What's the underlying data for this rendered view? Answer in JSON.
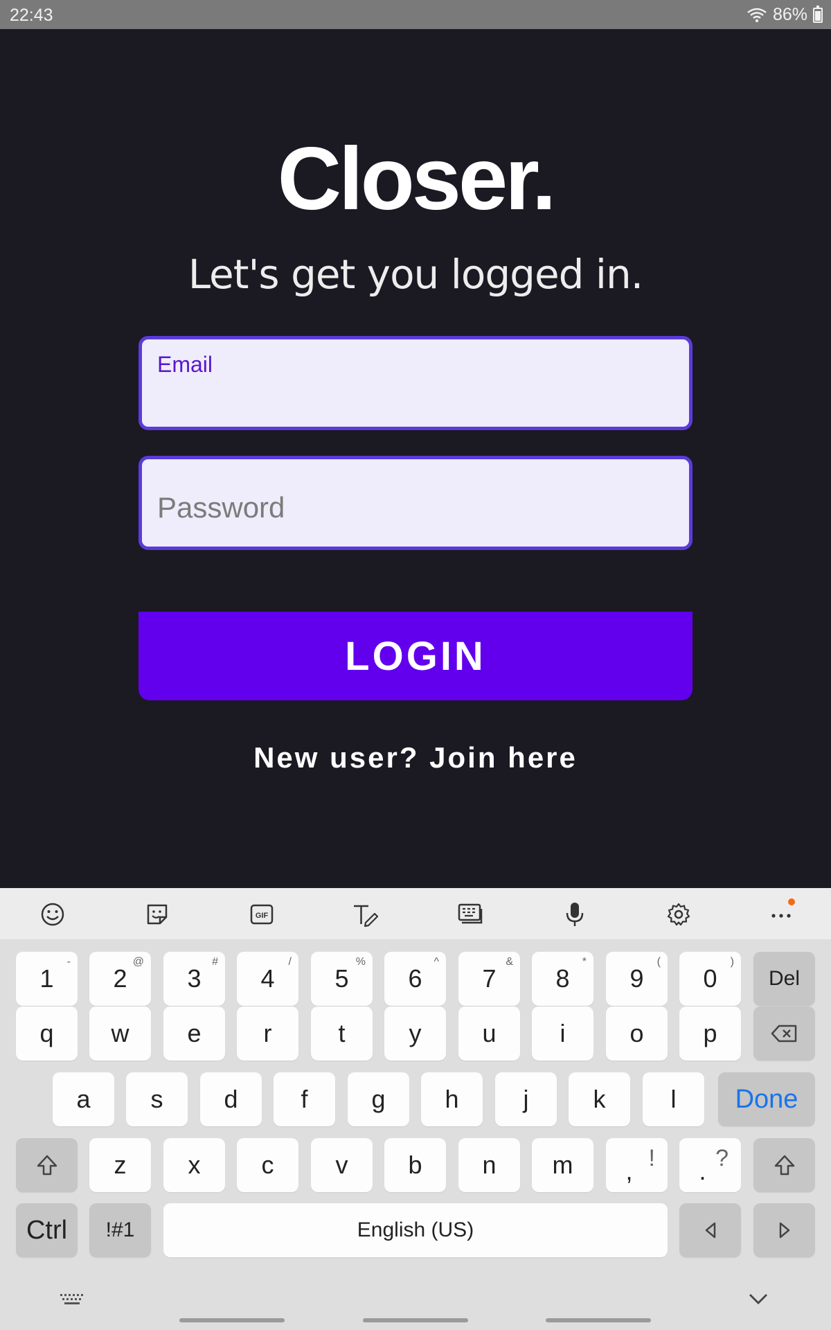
{
  "status_bar": {
    "time": "22:43",
    "battery": "86%"
  },
  "app": {
    "title": "Closer.",
    "subtitle": "Let's get you logged in.",
    "email_label": "Email",
    "email_value": "",
    "password_placeholder": "Password",
    "login_label": "LOGIN",
    "join_label": "New user? Join here",
    "colors": {
      "background": "#1b1922",
      "accent": "#6200ee",
      "field_border": "#5b3bd9",
      "field_bg": "#efedfb"
    }
  },
  "keyboard": {
    "toolbar": [
      "emoji-icon",
      "sticker-icon",
      "gif-icon",
      "handwriting-icon",
      "keyboard-layout-icon",
      "microphone-icon",
      "settings-icon",
      "more-icon"
    ],
    "gif_label": "GIF",
    "row_numbers": [
      {
        "k": "1",
        "s": "-"
      },
      {
        "k": "2",
        "s": "@"
      },
      {
        "k": "3",
        "s": "#"
      },
      {
        "k": "4",
        "s": "/"
      },
      {
        "k": "5",
        "s": "%"
      },
      {
        "k": "6",
        "s": "^"
      },
      {
        "k": "7",
        "s": "&"
      },
      {
        "k": "8",
        "s": "*"
      },
      {
        "k": "9",
        "s": "("
      },
      {
        "k": "0",
        "s": ")"
      }
    ],
    "del_label": "Del",
    "row_q": [
      "q",
      "w",
      "e",
      "r",
      "t",
      "y",
      "u",
      "i",
      "o",
      "p"
    ],
    "row_a": [
      "a",
      "s",
      "d",
      "f",
      "g",
      "h",
      "j",
      "k",
      "l"
    ],
    "done_label": "Done",
    "row_z": [
      "z",
      "x",
      "c",
      "v",
      "b",
      "n",
      "m"
    ],
    "comma": {
      "k": ",",
      "s": "!"
    },
    "period": {
      "k": ".",
      "s": "?"
    },
    "ctrl_label": "Ctrl",
    "symbols_label": "!#1",
    "space_label": "English (US)"
  }
}
